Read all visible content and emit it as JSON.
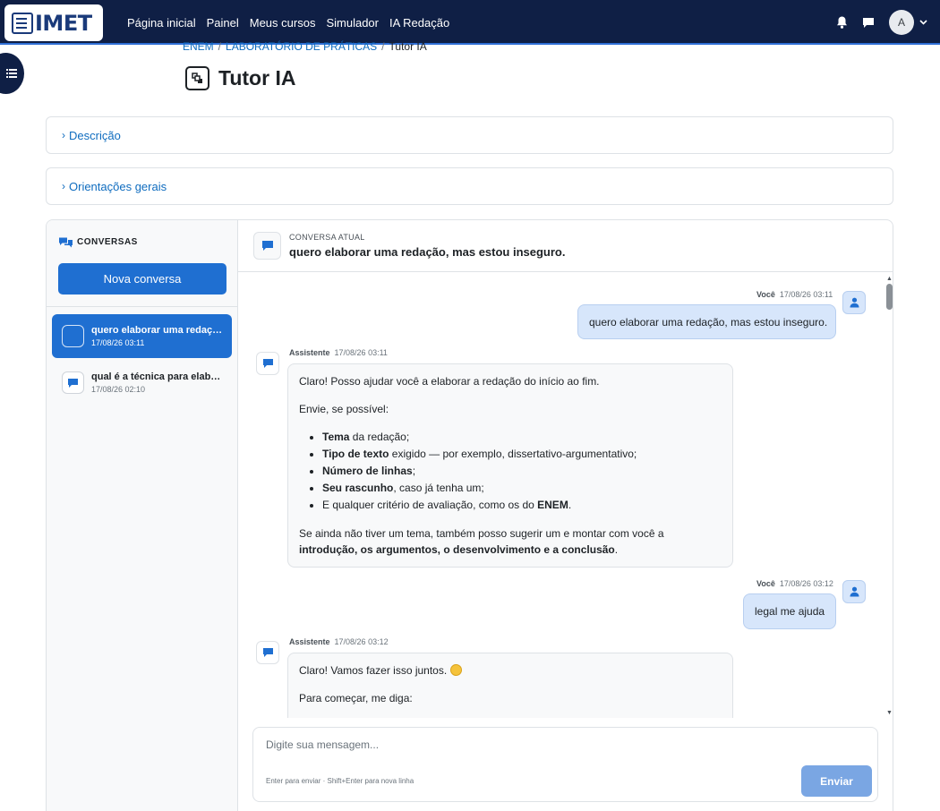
{
  "brand": {
    "logo_text": "IMET"
  },
  "nav": {
    "links": [
      "Página inicial",
      "Painel",
      "Meus cursos",
      "Simulador",
      "IA Redação"
    ],
    "avatar_initial": "A"
  },
  "breadcrumb": {
    "items": [
      "ENEM",
      "LABORATÓRIO DE PRÁTICAS"
    ],
    "current": "Tutor IA"
  },
  "page": {
    "title": "Tutor IA"
  },
  "sections": {
    "description": "Descrição",
    "guidelines": "Orientações gerais"
  },
  "sidebar": {
    "heading": "CONVERSAS",
    "new_button": "Nova conversa",
    "conversations": [
      {
        "title": "quero elaborar uma redação, mas estou inseguro.",
        "date": "17/08/26 03:11",
        "active": true
      },
      {
        "title": "qual é a técnica para elaborar uma redação?",
        "date": "17/08/26 02:10",
        "active": false
      }
    ]
  },
  "chat": {
    "header_label": "CONVERSA ATUAL",
    "header_title": "quero elaborar uma redação, mas estou inseguro.",
    "user_name": "Você",
    "assistant_name": "Assistente",
    "messages": [
      {
        "role": "user",
        "time": "17/08/26 03:11",
        "text": "quero elaborar uma redação, mas estou inseguro."
      },
      {
        "role": "assistant",
        "time": "17/08/26 03:11",
        "intro": "Claro! Posso ajudar você a elaborar a redação do início ao fim.",
        "ask": "Envie, se possível:",
        "list": [
          {
            "bold": "Tema",
            "rest": " da redação;"
          },
          {
            "bold": "Tipo de texto",
            "rest": " exigido — por exemplo, dissertativo-argumentativo;"
          },
          {
            "bold": "Número de linhas",
            "rest": ";"
          },
          {
            "bold": "Seu rascunho",
            "rest": ", caso já tenha um;"
          },
          {
            "pre": "E qualquer critério de avaliação, como os do ",
            "bold": "ENEM",
            "rest": "."
          }
        ],
        "outro_pre": "Se ainda não tiver um tema, também posso sugerir um e montar com você a ",
        "outro_bold": "introdução, os argumentos, o desenvolvimento e a conclusão",
        "outro_post": "."
      },
      {
        "role": "user",
        "time": "17/08/26 03:12",
        "text": "legal me ajuda"
      },
      {
        "role": "assistant",
        "time": "17/08/26 03:12",
        "line1": "Claro! Vamos fazer isso juntos.",
        "line2": "Para começar, me diga:"
      }
    ]
  },
  "composer": {
    "placeholder": "Digite sua mensagem...",
    "hint": "Enter para enviar · Shift+Enter para nova linha",
    "send_label": "Enviar"
  },
  "colors": {
    "nav_bg": "#0f1f45",
    "primary": "#1f6fd1",
    "user_bubble": "#d7e6fb",
    "link": "#0f6cbf"
  }
}
